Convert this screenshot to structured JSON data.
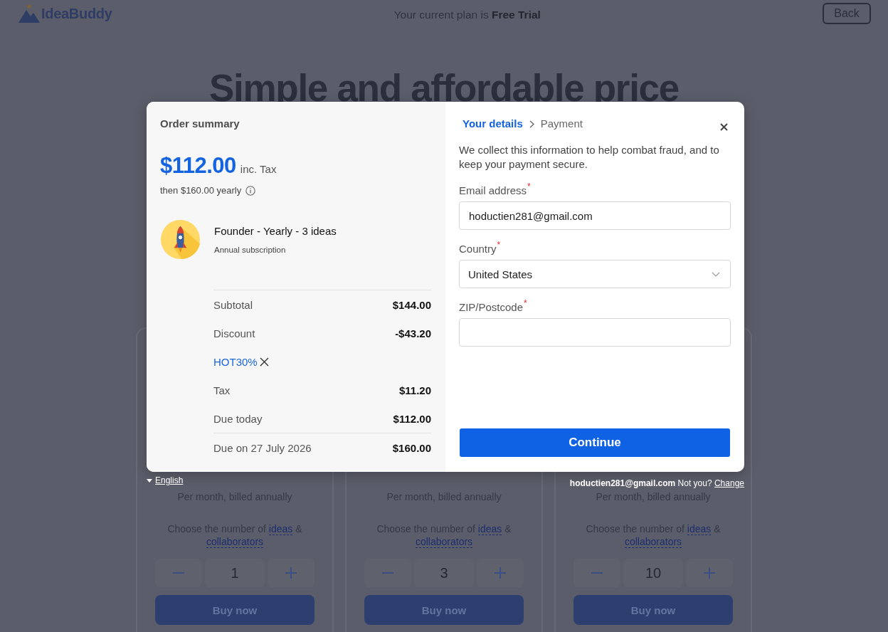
{
  "header": {
    "logo": "IdeaBuddy",
    "plan_note": "Your current plan is **Free Trial**",
    "back_button": "Back"
  },
  "hero": {
    "title": "Simple and affordable price"
  },
  "plans": [
    {
      "billing": "Per month, billed annually",
      "choose_prefix": "Choose the number of",
      "ideas_link": "ideas",
      "joiner": "&",
      "collaborators_link": "collaborators",
      "quantity": "1",
      "buy_button": "Buy now"
    },
    {
      "billing": "Per month, billed annually",
      "choose_prefix": "Choose the number of",
      "ideas_link": "ideas",
      "joiner": "&",
      "collaborators_link": "collaborators",
      "quantity": "3",
      "buy_button": "Buy now"
    },
    {
      "billing": "Per month, billed annually",
      "choose_prefix": "Choose the number of",
      "ideas_link": "ideas",
      "joiner": "&",
      "collaborators_link": "collaborators",
      "quantity": "10",
      "buy_button": "Buy now"
    }
  ],
  "checkout": {
    "summary": {
      "title": "Order summary",
      "total": "$112.00",
      "tax_note": "inc. Tax",
      "recurring": "then $160.00 yearly",
      "product": {
        "name": "Founder - Yearly - 3 ideas",
        "type": "Annual subscription"
      },
      "lines": [
        {
          "kind": "amount",
          "label": "Subtotal",
          "value": "$144.00"
        },
        {
          "kind": "amount",
          "label": "Discount",
          "value": "-$43.20"
        },
        {
          "kind": "coupon",
          "label": "HOT30%"
        },
        {
          "kind": "amount",
          "label": "Tax",
          "value": "$11.20"
        },
        {
          "kind": "amount",
          "label": "Due today",
          "value": "$112.00"
        },
        {
          "kind": "due_later",
          "label": "Due on 27 July 2026",
          "value": "$160.00"
        }
      ]
    },
    "steps": [
      {
        "label": "Your details",
        "selected": true
      },
      {
        "label": "Payment",
        "selected": false
      }
    ],
    "description": "We collect this information to help combat fraud, and to keep your payment secure.",
    "fields": [
      {
        "kind": "text",
        "label": "Email address",
        "required_mark": "*",
        "value": "hoductien281@gmail.com"
      },
      {
        "kind": "select",
        "label": "Country",
        "required_mark": "*",
        "value": "United States"
      },
      {
        "kind": "text",
        "label": "ZIP/Postcode",
        "required_mark": "*"
      }
    ],
    "continue_button": "Continue"
  },
  "footer": {
    "language": "English",
    "email": "hoductien281@gmail.com",
    "prompt": "Not you?",
    "change_link": "Change"
  }
}
